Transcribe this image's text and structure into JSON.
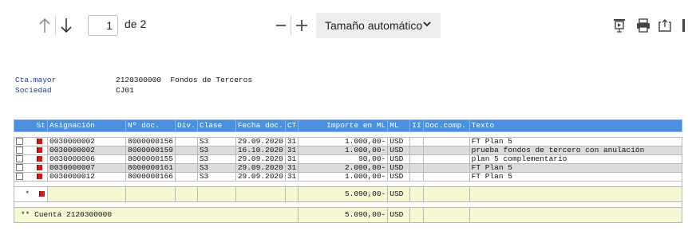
{
  "toolbar": {
    "prev_icon": "arrow-up-icon",
    "next_icon": "arrow-down-icon",
    "page_current": "1",
    "page_of": "de 2",
    "zoom_out_icon": "minus-icon",
    "zoom_in_icon": "plus-icon",
    "zoom_label": "Tamaño automático",
    "right_icons": [
      "presentation-icon",
      "print-icon",
      "save-icon"
    ]
  },
  "header": {
    "cta_label": "Cta.mayor",
    "cta_value": "2120300000  Fondos de Terceros",
    "soc_label": "Sociedad",
    "soc_value": "CJ01"
  },
  "table": {
    "columns": [
      "St",
      "Asignación",
      "Nº doc.",
      "Div.",
      "Clase",
      "Fecha doc.",
      "CT",
      "Importe en ML",
      "ML",
      "II",
      "Doc.comp.",
      "Texto"
    ],
    "rows": [
      {
        "asignacion": "0030000002",
        "ndoc": "8000000156",
        "div": "",
        "clase": "S3",
        "fecha": "29.09.2020",
        "ct": "31",
        "importe": "1.000,00-",
        "ml": "USD",
        "ii": "",
        "doccomp": "",
        "texto": "FT Plan 5"
      },
      {
        "asignacion": "0030000002",
        "ndoc": "8000000159",
        "div": "",
        "clase": "S3",
        "fecha": "16.10.2020",
        "ct": "31",
        "importe": "1.000,00-",
        "ml": "USD",
        "ii": "",
        "doccomp": "",
        "texto": "prueba fondos de tercero con anulación"
      },
      {
        "asignacion": "0030000006",
        "ndoc": "8000000155",
        "div": "",
        "clase": "S3",
        "fecha": "29.09.2020",
        "ct": "31",
        "importe": "90,00-",
        "ml": "USD",
        "ii": "",
        "doccomp": "",
        "texto": "plan 5 complementario"
      },
      {
        "asignacion": "0030000007",
        "ndoc": "8000000161",
        "div": "",
        "clase": "S3",
        "fecha": "29.09.2020",
        "ct": "31",
        "importe": "2.000,00-",
        "ml": "USD",
        "ii": "",
        "doccomp": "",
        "texto": "FT Plan 5"
      },
      {
        "asignacion": "0030000012",
        "ndoc": "8000000166",
        "div": "",
        "clase": "S3",
        "fecha": "29.09.2020",
        "ct": "31",
        "importe": "1.000,00-",
        "ml": "USD",
        "ii": "",
        "doccomp": "",
        "texto": "FT Plan 5"
      }
    ],
    "total_marker": "*",
    "total_importe": "5.090,00-",
    "total_ml": "USD",
    "account_total_label": "** Cuenta 2120300000",
    "account_total_importe": "5.090,00-",
    "account_total_ml": "USD"
  }
}
